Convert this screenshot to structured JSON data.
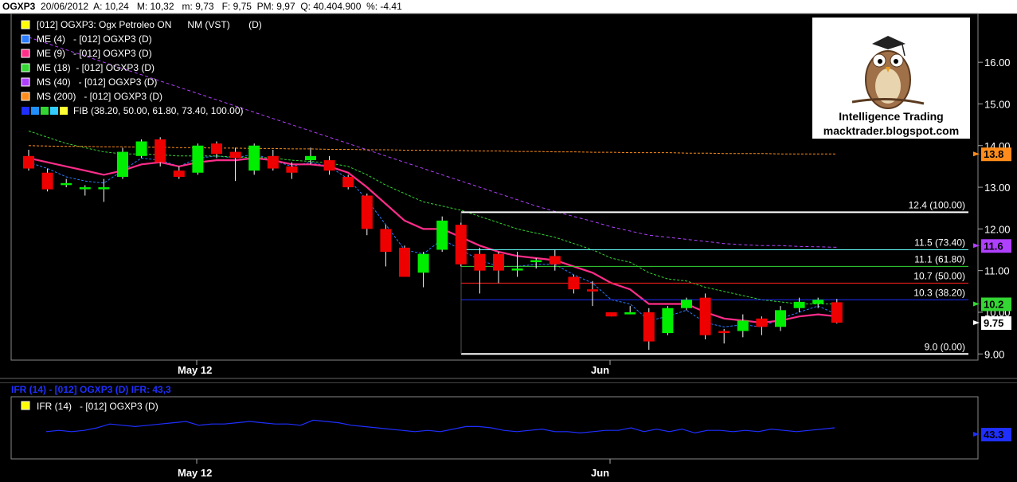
{
  "header": {
    "symbol": "OGXP3",
    "date": "20/06/2012",
    "open": "A: 10,24",
    "high": "M: 10,32",
    "low": "m: 9,73",
    "close": "F: 9,75",
    "avg": "PM: 9,97",
    "volume": "Q: 40.404.900",
    "change": "%: -4.41"
  },
  "legend": [
    {
      "label": "[012] OGXP3: Ogx Petroleo ON      NM (VST)       (D)",
      "color": "#ffff00"
    },
    {
      "label": "ME (4)   - [012] OGXP3 (D)",
      "color": "#2b7cff"
    },
    {
      "label": "ME (9)   - [012] OGXP3 (D)",
      "color": "#ff2d8a"
    },
    {
      "label": "ME (18)  - [012] OGXP3 (D)",
      "color": "#33d633"
    },
    {
      "label": "MS (40)   - [012] OGXP3 (D)",
      "color": "#b040ff"
    },
    {
      "label": "MS (200)   - [012] OGXP3 (D)",
      "color": "#ff8c1a"
    },
    {
      "label": "FIB (38.20, 50.00, 61.80, 73.40, 100.00)",
      "color": "#ffffff"
    }
  ],
  "logo": {
    "line1": "Intelligence Trading",
    "line2": "macktrader.blogspot.com"
  },
  "ifr": {
    "header": "IFR (14)  - [012] OGXP3 (D)  IFR: 43,3",
    "legend": "IFR (14)   - [012] OGXP3 (D)",
    "value_label": "43.3",
    "values": [
      44,
      45,
      44,
      45,
      47,
      50,
      49,
      48,
      49,
      50,
      51,
      52,
      49,
      50,
      50,
      51,
      52,
      51,
      50,
      50,
      49,
      53,
      52,
      51,
      49,
      48,
      47,
      46,
      45,
      44,
      45,
      44,
      46,
      48,
      48,
      47,
      45,
      44,
      45,
      46,
      44,
      44,
      43,
      44,
      45,
      45,
      47,
      44,
      46,
      44,
      46,
      43,
      45,
      45,
      44,
      45,
      44,
      46,
      45,
      44,
      45,
      46,
      47
    ],
    "colors": {
      "line": "#1f2fff"
    }
  },
  "x_labels": [
    "May 12",
    "Jun"
  ],
  "right_labels": [
    {
      "text": "13.8",
      "bg": "#ff8c1a",
      "fg": "#000"
    },
    {
      "text": "11.6",
      "bg": "#b040ff",
      "fg": "#000"
    },
    {
      "text": "10.2",
      "bg": "#33d633",
      "fg": "#000"
    },
    {
      "text": "9.75",
      "bg": "#ffffff",
      "fg": "#000"
    }
  ],
  "chart_data": {
    "type": "candlestick",
    "title": "OGXP3",
    "ylim": [
      8.0,
      17.0
    ],
    "yticks": [
      "16.00",
      "15.00",
      "14.00",
      "13.00",
      "12.00",
      "11.00",
      "10.00",
      "9.00"
    ],
    "ytick_values": [
      16,
      15,
      14,
      13,
      12,
      11,
      10,
      9
    ],
    "candles": [
      [
        13.75,
        13.45,
        13.9,
        13.4
      ],
      [
        13.35,
        12.95,
        13.45,
        12.9
      ],
      [
        13.1,
        13.1,
        13.2,
        13.0
      ],
      [
        13.0,
        13.0,
        13.05,
        12.8
      ],
      [
        13.0,
        13.0,
        13.2,
        12.65
      ],
      [
        13.25,
        13.85,
        13.95,
        13.2
      ],
      [
        13.75,
        14.1,
        14.15,
        13.7
      ],
      [
        14.15,
        13.6,
        14.2,
        13.5
      ],
      [
        13.4,
        13.25,
        13.5,
        13.2
      ],
      [
        13.35,
        14.0,
        14.05,
        13.3
      ],
      [
        14.05,
        13.8,
        14.1,
        13.7
      ],
      [
        13.85,
        13.7,
        13.95,
        13.15
      ],
      [
        13.4,
        14.0,
        14.05,
        13.3
      ],
      [
        13.75,
        13.45,
        13.9,
        13.4
      ],
      [
        13.5,
        13.35,
        13.6,
        13.2
      ],
      [
        13.65,
        13.75,
        13.95,
        13.55
      ],
      [
        13.65,
        13.4,
        13.75,
        13.3
      ],
      [
        13.25,
        13.0,
        13.3,
        12.95
      ],
      [
        12.8,
        12.0,
        12.85,
        11.85
      ],
      [
        12.0,
        11.45,
        12.1,
        11.1
      ],
      [
        11.55,
        10.85,
        11.6,
        10.85
      ],
      [
        10.95,
        11.4,
        11.45,
        10.6
      ],
      [
        11.5,
        12.2,
        12.3,
        11.45
      ],
      [
        12.1,
        11.15,
        12.15,
        11.1
      ],
      [
        11.4,
        11.0,
        11.55,
        10.45
      ],
      [
        11.4,
        11.0,
        11.45,
        10.7
      ],
      [
        11.05,
        11.05,
        11.45,
        10.85
      ],
      [
        11.25,
        11.25,
        11.3,
        11.05
      ],
      [
        11.35,
        11.15,
        11.5,
        11.0
      ],
      [
        10.85,
        10.55,
        10.9,
        10.45
      ],
      [
        10.55,
        10.5,
        10.75,
        10.15
      ],
      [
        10.0,
        9.9,
        10.0,
        9.9
      ],
      [
        9.95,
        10.0,
        10.15,
        9.95
      ],
      [
        10.0,
        9.3,
        10.1,
        9.1
      ],
      [
        9.5,
        10.1,
        10.15,
        9.45
      ],
      [
        10.1,
        10.3,
        10.35,
        10.05
      ],
      [
        10.35,
        9.45,
        10.45,
        9.35
      ],
      [
        9.55,
        9.5,
        9.6,
        9.25
      ],
      [
        9.55,
        9.8,
        9.95,
        9.4
      ],
      [
        9.85,
        9.65,
        9.9,
        9.45
      ],
      [
        9.65,
        10.05,
        10.15,
        9.55
      ],
      [
        10.1,
        10.25,
        10.35,
        10.0
      ],
      [
        10.2,
        10.3,
        10.35,
        10.1
      ],
      [
        10.24,
        9.75,
        10.32,
        9.73
      ]
    ],
    "series": [
      {
        "name": "ME (4)",
        "values": [
          13.6,
          13.45,
          13.25,
          13.15,
          13.1,
          13.4,
          13.7,
          13.65,
          13.5,
          13.7,
          13.75,
          13.7,
          13.8,
          13.65,
          13.5,
          13.6,
          13.5,
          13.2,
          12.7,
          12.1,
          11.5,
          11.4,
          11.75,
          11.5,
          11.25,
          11.1,
          11.1,
          11.15,
          11.15,
          10.9,
          10.7,
          10.3,
          10.2,
          9.8,
          9.9,
          10.05,
          9.75,
          9.65,
          9.7,
          9.65,
          9.85,
          10.0,
          10.15,
          9.95
        ]
      },
      {
        "name": "ME (9)",
        "values": [
          13.7,
          13.6,
          13.5,
          13.4,
          13.3,
          13.4,
          13.55,
          13.6,
          13.5,
          13.6,
          13.65,
          13.65,
          13.7,
          13.65,
          13.55,
          13.55,
          13.5,
          13.35,
          13.0,
          12.6,
          12.2,
          12.0,
          12.0,
          11.8,
          11.6,
          11.45,
          11.35,
          11.3,
          11.25,
          11.1,
          10.95,
          10.7,
          10.55,
          10.2,
          10.2,
          10.2,
          10.0,
          9.85,
          9.8,
          9.75,
          9.8,
          9.9,
          9.95,
          9.9
        ]
      },
      {
        "name": "ME (18)",
        "values": [
          14.35,
          14.2,
          14.05,
          13.95,
          13.85,
          13.8,
          13.8,
          13.78,
          13.75,
          13.75,
          13.75,
          13.72,
          13.72,
          13.7,
          13.65,
          13.62,
          13.58,
          13.5,
          13.3,
          13.05,
          12.85,
          12.65,
          12.55,
          12.45,
          12.3,
          12.15,
          12.0,
          11.9,
          11.8,
          11.65,
          11.5,
          11.3,
          11.2,
          10.95,
          10.8,
          10.75,
          10.6,
          10.5,
          10.4,
          10.3,
          10.25,
          10.2,
          10.2,
          10.2
        ]
      },
      {
        "name": "MS (40)",
        "values": [
          16.6,
          16.45,
          16.3,
          16.15,
          16.0,
          15.85,
          15.7,
          15.55,
          15.4,
          15.25,
          15.1,
          14.95,
          14.8,
          14.65,
          14.5,
          14.35,
          14.2,
          14.05,
          13.9,
          13.75,
          13.6,
          13.45,
          13.3,
          13.15,
          13.0,
          12.85,
          12.7,
          12.55,
          12.42,
          12.3,
          12.18,
          12.05,
          11.95,
          11.85,
          11.8,
          11.75,
          11.7,
          11.65,
          11.62,
          11.6,
          11.6,
          11.58,
          11.57,
          11.56
        ]
      },
      {
        "name": "MS (200)",
        "values": [
          14.0,
          13.99,
          13.98,
          13.98,
          13.97,
          13.97,
          13.96,
          13.96,
          13.95,
          13.95,
          13.94,
          13.94,
          13.93,
          13.93,
          13.92,
          13.92,
          13.91,
          13.91,
          13.9,
          13.9,
          13.89,
          13.89,
          13.88,
          13.88,
          13.87,
          13.87,
          13.86,
          13.86,
          13.85,
          13.85,
          13.84,
          13.84,
          13.83,
          13.83,
          13.83,
          13.82,
          13.82,
          13.81,
          13.81,
          13.81,
          13.8,
          13.8,
          13.8,
          13.8
        ]
      }
    ],
    "fibonacci": [
      {
        "label": "12.4 (100.00)",
        "value": 12.4,
        "color": "#ffffff"
      },
      {
        "label": "11.5 (73.40)",
        "value": 11.5,
        "color": "#66ffff"
      },
      {
        "label": "11.1 (61.80)",
        "value": 11.1,
        "color": "#33d633"
      },
      {
        "label": "10.7 (50.00)",
        "value": 10.7,
        "color": "#ff2020"
      },
      {
        "label": "10.3 (38.20)",
        "value": 10.3,
        "color": "#2030ff"
      },
      {
        "label": "9.0 (0.00)",
        "value": 9.0,
        "color": "#ffffff"
      }
    ],
    "colors": {
      "up": "#00ee00",
      "down": "#ee0000"
    }
  }
}
